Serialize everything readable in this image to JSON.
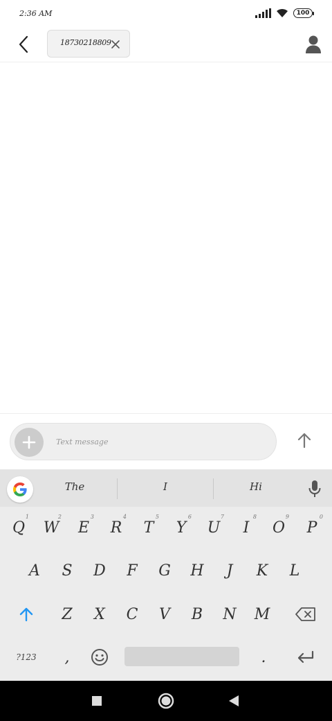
{
  "status_bar": {
    "time": "2:36 AM",
    "battery": "100",
    "icons": [
      "signal-icon",
      "wifi-icon",
      "battery-icon"
    ]
  },
  "top_bar": {
    "recipient": "18730218809",
    "icons": [
      "back-arrow-icon",
      "close-icon",
      "contact-icon"
    ]
  },
  "compose": {
    "placeholder": "Text message",
    "icons": [
      "plus-icon",
      "send-arrow-icon"
    ]
  },
  "keyboard": {
    "suggestions": [
      "The",
      "I",
      "Hi"
    ],
    "row1": [
      {
        "key": "Q",
        "hint": "1"
      },
      {
        "key": "W",
        "hint": "2"
      },
      {
        "key": "E",
        "hint": "3"
      },
      {
        "key": "R",
        "hint": "4"
      },
      {
        "key": "T",
        "hint": "5"
      },
      {
        "key": "Y",
        "hint": "6"
      },
      {
        "key": "U",
        "hint": "7"
      },
      {
        "key": "I",
        "hint": "8"
      },
      {
        "key": "O",
        "hint": "9"
      },
      {
        "key": "P",
        "hint": "0"
      }
    ],
    "row2": [
      "A",
      "S",
      "D",
      "F",
      "G",
      "H",
      "J",
      "K",
      "L"
    ],
    "row3": [
      "Z",
      "X",
      "C",
      "V",
      "B",
      "N",
      "M"
    ],
    "symbols_label": "?123",
    "comma": ",",
    "period": ".",
    "icons": [
      "google-icon",
      "mic-icon",
      "shift-icon",
      "backspace-icon",
      "emoji-icon",
      "enter-icon"
    ]
  },
  "nav_bar": {
    "icons": [
      "recents-icon",
      "home-icon",
      "back-icon"
    ]
  },
  "colors": {
    "accent": "#2196F3",
    "keyboard_bg": "#ececec",
    "suggestion_bg": "#e3e3e3",
    "nav_bg": "#000000"
  }
}
